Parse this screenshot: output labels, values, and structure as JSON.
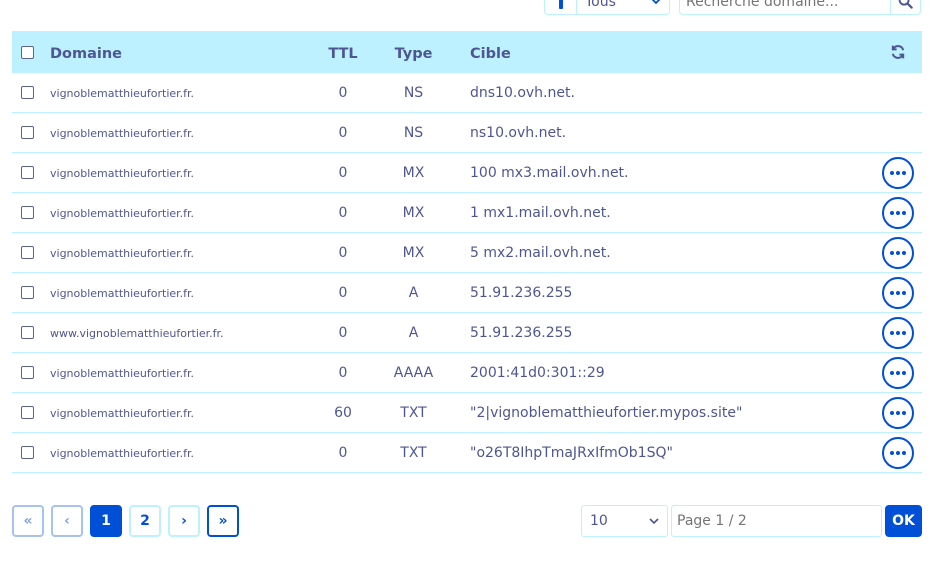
{
  "filter": {
    "select_value": "Tous",
    "search_placeholder": "Recherche domaine..."
  },
  "table": {
    "headers": {
      "domain": "Domaine",
      "ttl": "TTL",
      "type": "Type",
      "target": "Cible"
    },
    "rows": [
      {
        "domain": "vignoblematthieufortier.fr.",
        "ttl": "0",
        "type": "NS",
        "target": "dns10.ovh.net.",
        "has_actions": false
      },
      {
        "domain": "vignoblematthieufortier.fr.",
        "ttl": "0",
        "type": "NS",
        "target": "ns10.ovh.net.",
        "has_actions": false
      },
      {
        "domain": "vignoblematthieufortier.fr.",
        "ttl": "0",
        "type": "MX",
        "target": "100 mx3.mail.ovh.net.",
        "has_actions": true
      },
      {
        "domain": "vignoblematthieufortier.fr.",
        "ttl": "0",
        "type": "MX",
        "target": "1 mx1.mail.ovh.net.",
        "has_actions": true
      },
      {
        "domain": "vignoblematthieufortier.fr.",
        "ttl": "0",
        "type": "MX",
        "target": "5 mx2.mail.ovh.net.",
        "has_actions": true
      },
      {
        "domain": "vignoblematthieufortier.fr.",
        "ttl": "0",
        "type": "A",
        "target": "51.91.236.255",
        "has_actions": true
      },
      {
        "domain": "www.vignoblematthieufortier.fr.",
        "ttl": "0",
        "type": "A",
        "target": "51.91.236.255",
        "has_actions": true
      },
      {
        "domain": "vignoblematthieufortier.fr.",
        "ttl": "0",
        "type": "AAAA",
        "target": "2001:41d0:301::29",
        "has_actions": true
      },
      {
        "domain": "vignoblematthieufortier.fr.",
        "ttl": "60",
        "type": "TXT",
        "target": "\"2|vignoblematthieufortier.mypos.site\"",
        "has_actions": true
      },
      {
        "domain": "vignoblematthieufortier.fr.",
        "ttl": "0",
        "type": "TXT",
        "target": "\"o26T8IhpTmaJRxIfmOb1SQ\"",
        "has_actions": true
      }
    ]
  },
  "pagination": {
    "first": "«",
    "prev": "‹",
    "pages": [
      "1",
      "2"
    ],
    "current_page": "1",
    "next": "›",
    "last": "»",
    "per_page": "10",
    "page_placeholder": "Page 1 / 2",
    "ok_label": "OK"
  },
  "colors": {
    "accent": "#0050d7",
    "header_bg": "#bef1ff",
    "text": "#4d5693"
  },
  "icons": {
    "search": "search-icon",
    "refresh": "refresh-icon",
    "more": "more-actions-icon",
    "filter_chevron": "chevron-down-icon"
  }
}
